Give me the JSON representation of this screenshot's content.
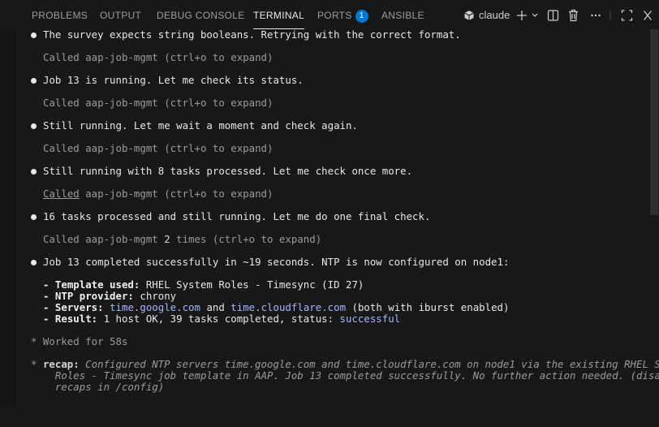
{
  "tabs": [
    {
      "label": "PROBLEMS"
    },
    {
      "label": "OUTPUT"
    },
    {
      "label": "DEBUG CONSOLE"
    },
    {
      "label": "TERMINAL"
    },
    {
      "label": "PORTS",
      "badge": "1"
    },
    {
      "label": "ANSIBLE"
    }
  ],
  "toolbar": {
    "terminal_name": "claude"
  },
  "colors": {
    "background": "#181818",
    "accent": "#0078d4",
    "link": "#a5b4fc"
  },
  "terminal": {
    "l1": "The survey expects string booleans. Retrying with the correct format.",
    "c1": "Called aap-job-mgmt (ctrl+o to expand)",
    "l2": "Job 13 is running. Let me check its status.",
    "c2": "Called aap-job-mgmt (ctrl+o to expand)",
    "l3": "Still running. Let me wait a moment and check again.",
    "c3": "Called aap-job-mgmt (ctrl+o to expand)",
    "l4": "Still running with 8 tasks processed. Let me check once more.",
    "c4_link": "Called",
    "c4_rest": " aap-job-mgmt (ctrl+o to expand)",
    "l5": "16 tasks processed and still running. Let me do one final check.",
    "c5_a": "Called aap-job-mgmt ",
    "c5_b": "2",
    "c5_c": " times (ctrl+o to expand)",
    "l6": "Job 13 completed successfully in ~19 seconds. NTP is now configured on node1:",
    "d1_label": "- Template used:",
    "d1_val": " RHEL System Roles - Timesync (ID 27)",
    "d2_label": "- NTP provider:",
    "d2_val": " chrony",
    "d3_label": "- Servers:",
    "d3_s1": "time.google.com",
    "d3_and": " and ",
    "d3_s2": "time.cloudflare.com",
    "d3_tail": " (both with iburst enabled)",
    "d4_label": "- Result:",
    "d4_val": " 1 host OK, 39 tasks completed, status: ",
    "d4_status": "successful",
    "worked_star": "*",
    "worked": " Worked for 58s",
    "recap_star": "*",
    "recap_label": "recap:",
    "recap_1": " Configured NTP servers time.google.com and time.cloudflare.com on node1 via the existing RHEL System",
    "recap_2": "  Roles - Timesync job template in AAP. Job 13 completed successfully. No further action needed. (disable",
    "recap_3": "  recaps in /config)"
  }
}
